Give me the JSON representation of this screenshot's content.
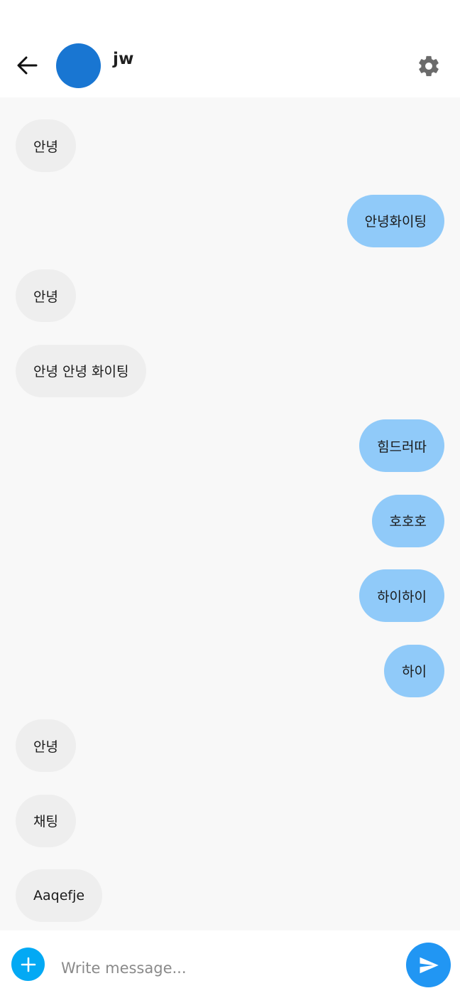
{
  "header": {
    "contact_name": "jw",
    "avatar_color": "#1976d2",
    "back_icon": "arrow-left-icon",
    "settings_icon": "gear-icon"
  },
  "messages": [
    {
      "direction": "received",
      "text": "안녕"
    },
    {
      "direction": "sent",
      "text": "안녕화이팅"
    },
    {
      "direction": "received",
      "text": "안녕"
    },
    {
      "direction": "received",
      "text": "안녕 안녕 화이팅"
    },
    {
      "direction": "sent",
      "text": "힘드러따"
    },
    {
      "direction": "sent",
      "text": "호호호"
    },
    {
      "direction": "sent",
      "text": "하이하이"
    },
    {
      "direction": "sent",
      "text": "하이"
    },
    {
      "direction": "received",
      "text": "안녕"
    },
    {
      "direction": "received",
      "text": "채팅"
    },
    {
      "direction": "received",
      "text": "Aaqefje"
    }
  ],
  "composer": {
    "placeholder": "Write message...",
    "value": "",
    "add_icon": "plus-icon",
    "send_icon": "send-icon"
  },
  "colors": {
    "sent_bubble": "#90caf9",
    "received_bubble": "#eeeeee",
    "add_button": "#03a9f4",
    "send_button": "#2196f3",
    "chat_background": "#f8f8f8"
  }
}
